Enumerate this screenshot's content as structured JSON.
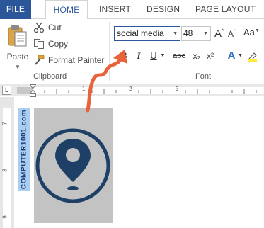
{
  "tabs": {
    "file": "FILE",
    "home": "HOME",
    "insert": "INSERT",
    "design": "DESIGN",
    "page_layout": "PAGE LAYOUT"
  },
  "clipboard": {
    "paste_label": "Paste",
    "cut_label": "Cut",
    "copy_label": "Copy",
    "format_painter_label": "Format Painter",
    "group_label": "Clipboard"
  },
  "font": {
    "group_label": "Font",
    "font_name": "social media",
    "font_size": "48",
    "bold": "B",
    "italic": "I",
    "underline": "U",
    "strikethrough": "abc",
    "subscript": "x₂",
    "superscript": "x²",
    "text_effects": "A",
    "grow": "A",
    "shrink": "A",
    "change_case": "Aa"
  },
  "ruler": {
    "marks": [
      "1",
      "2",
      "3"
    ],
    "tab_selector": "L",
    "vertical_marks": [
      "7",
      "8",
      "9"
    ]
  },
  "document": {
    "sidebar_text": "COMPUTER1001.com"
  },
  "colors": {
    "accent": "#2b579a",
    "arrow": "#e8623a",
    "icon": "#1e3f66"
  }
}
